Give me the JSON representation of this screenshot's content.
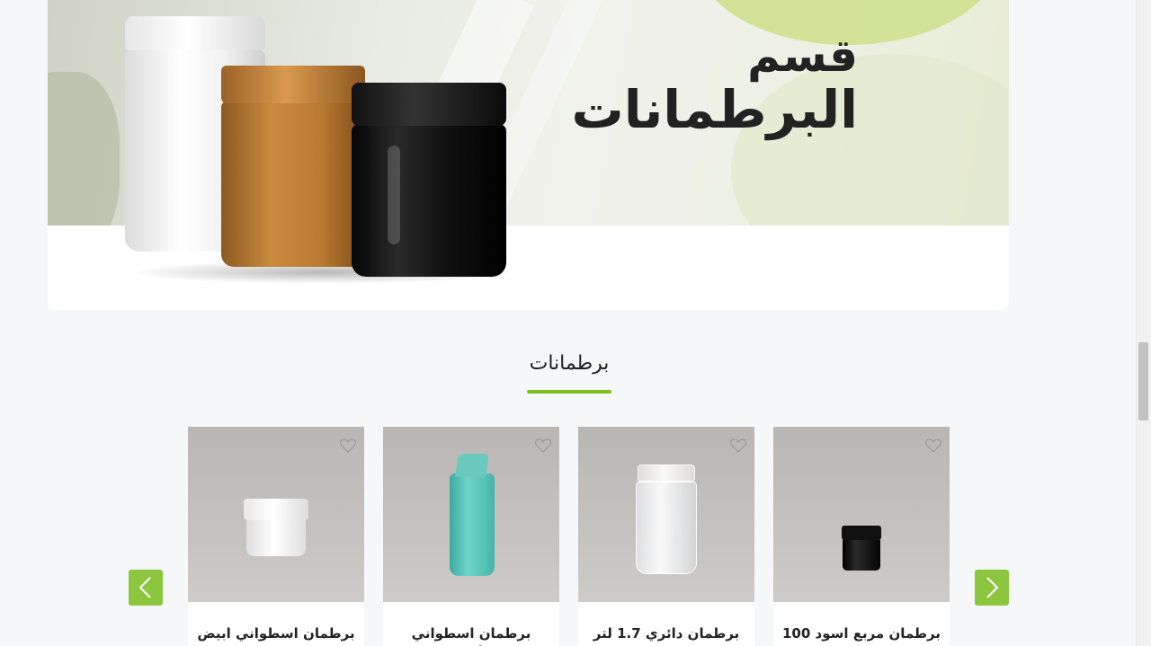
{
  "banner": {
    "title_line1": "قسم",
    "title_line2": "البرطمانات"
  },
  "section": {
    "title": "برطمانات",
    "accent_color": "#7fbf1f"
  },
  "carousel": {
    "arrow_color": "#8cc63f",
    "prev_icon": "chevron-left-icon",
    "next_icon": "chevron-right-icon",
    "products": [
      {
        "name": "برطمان اسطواني ابيض ...",
        "wishlist_icon": "heart-icon"
      },
      {
        "name": "برطمان اسطواني تيفاني ...",
        "wishlist_icon": "heart-icon"
      },
      {
        "name": "برطمان دائري 1.7 لتر",
        "wishlist_icon": "heart-icon"
      },
      {
        "name": "برطمان مربع اسود 100",
        "wishlist_icon": "heart-icon"
      }
    ]
  }
}
